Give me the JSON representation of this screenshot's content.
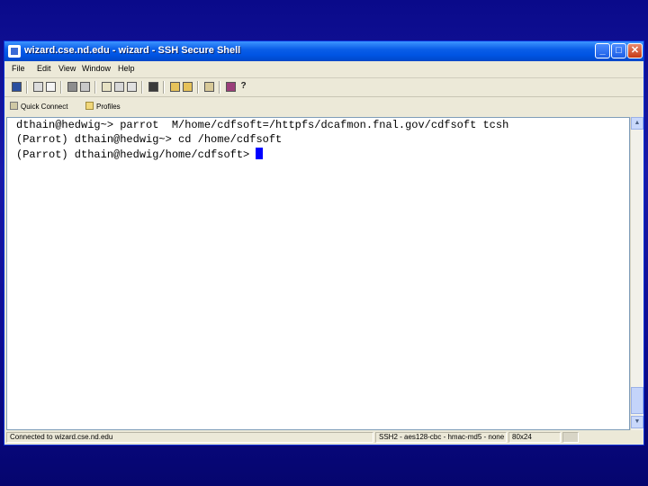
{
  "window": {
    "title": "wizard.cse.nd.edu - wizard - SSH Secure Shell",
    "controls": {
      "minimize": "_",
      "maximize": "□",
      "close": "✕"
    }
  },
  "menu": [
    "File",
    "Edit",
    "View",
    "Window",
    "Help"
  ],
  "quick_toolbar": {
    "quick_connect": "Quick Connect",
    "profiles": "Profiles"
  },
  "terminal": {
    "lines": [
      "dthain@hedwig~> parrot  M/home/cdfsoft=/httpfs/dcafmon.fnal.gov/cdfsoft tcsh",
      "(Parrot) dthain@hedwig~> cd /home/cdfsoft",
      "(Parrot) dthain@hedwig/home/cdfsoft> "
    ]
  },
  "statusbar": {
    "connection": "Connected to wizard.cse.nd.edu",
    "protocol": "SSH2 - aes128-cbc - hmac-md5 - none",
    "size": "80x24"
  },
  "colors": {
    "desktop": "#0d0d92",
    "titlebar": "#0054e3",
    "cursor": "#0000ff"
  },
  "icons": [
    "save-icon",
    "print-icon",
    "find-icon",
    "paste-icon",
    "settings-icon",
    "help-icon"
  ]
}
